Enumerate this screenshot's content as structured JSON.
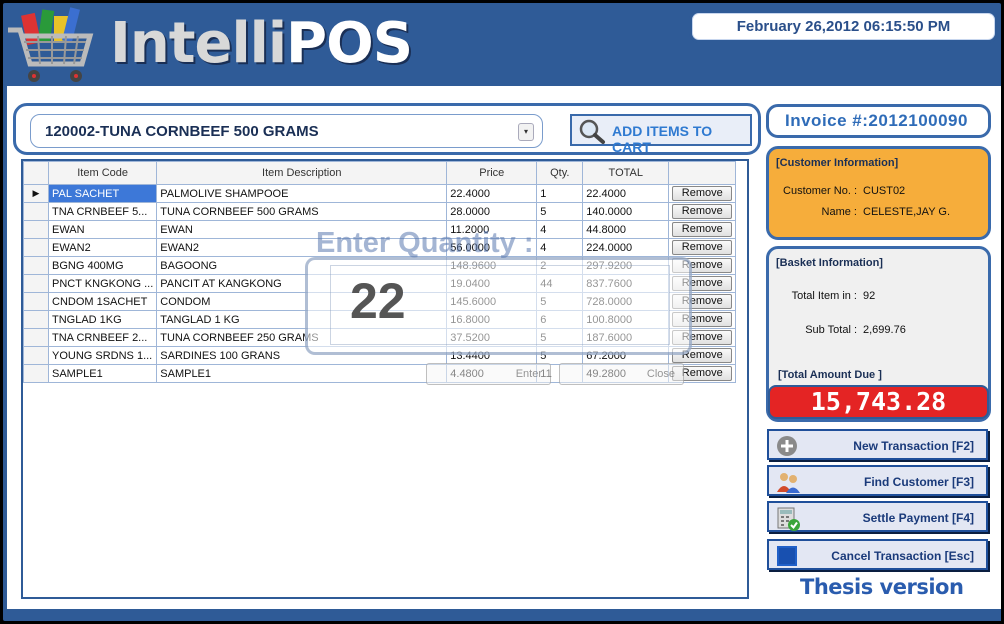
{
  "header": {
    "title_part1": "Intelli",
    "title_part2": "POS",
    "datetime": "February 26,2012 06:15:50 PM"
  },
  "search": {
    "selected_item": "120002-TUNA CORNBEEF 500 GRAMS",
    "add_button_label": "ADD ITEMS TO CART"
  },
  "grid": {
    "columns": [
      "Item Code",
      "Item Description",
      "Price",
      "Qty.",
      "TOTAL"
    ],
    "remove_label": "Remove",
    "rows": [
      {
        "code": "PAL SACHET",
        "desc": "PALMOLIVE SHAMPOOE",
        "price": "22.4000",
        "qty": "1",
        "total": "22.4000"
      },
      {
        "code": "TNA CRNBEEF 5...",
        "desc": "TUNA CORNBEEF 500 GRAMS",
        "price": "28.0000",
        "qty": "5",
        "total": "140.0000"
      },
      {
        "code": "EWAN",
        "desc": "EWAN",
        "price": "11.2000",
        "qty": "4",
        "total": "44.8000"
      },
      {
        "code": "EWAN2",
        "desc": "EWAN2",
        "price": "56.0000",
        "qty": "4",
        "total": "224.0000"
      },
      {
        "code": "BGNG 400MG",
        "desc": "BAGOONG",
        "price": "148.9600",
        "qty": "2",
        "total": "297.9200"
      },
      {
        "code": "PNCT KNGKONG ...",
        "desc": "PANCIT AT KANGKONG",
        "price": "19.0400",
        "qty": "44",
        "total": "837.7600"
      },
      {
        "code": "CNDOM 1SACHET",
        "desc": "CONDOM",
        "price": "145.6000",
        "qty": "5",
        "total": "728.0000"
      },
      {
        "code": "TNGLAD 1KG",
        "desc": "TANGLAD 1 KG",
        "price": "16.8000",
        "qty": "6",
        "total": "100.8000"
      },
      {
        "code": "TNA CRNBEEF 2...",
        "desc": "TUNA CORNBEEF 250 GRAMS",
        "price": "37.5200",
        "qty": "5",
        "total": "187.6000"
      },
      {
        "code": "YOUNG SRDNS 1...",
        "desc": "SARDINES 100 GRANS",
        "price": "13.4400",
        "qty": "5",
        "total": "67.2000"
      },
      {
        "code": "SAMPLE1",
        "desc": "SAMPLE1",
        "price": "4.4800",
        "qty": "11",
        "total": "49.2800"
      }
    ]
  },
  "quantity_dialog": {
    "title": "Enter Quantity :",
    "value": "22",
    "enter_label": "Enter",
    "close_label": "Close"
  },
  "invoice": {
    "label": "Invoice #:2012100090"
  },
  "customer": {
    "title": "[Customer Information]",
    "no_label": "Customer No. :",
    "no_value": "CUST02",
    "name_label": "Name :",
    "name_value": "CELESTE,JAY G."
  },
  "basket": {
    "title": "[Basket Information]",
    "items_label": "Total Item in :",
    "items_value": "92",
    "subtotal_label": "Sub Total :",
    "subtotal_value": "2,699.76",
    "due_label": "[Total Amount Due ]",
    "due_value": "15,743.28"
  },
  "actions": {
    "new": "New Transaction [F2]",
    "find": "Find Customer [F3]",
    "settle": "Settle Payment [F4]",
    "cancel": "Cancel Transaction [Esc]"
  },
  "footer": {
    "version": "Thesis version"
  },
  "colors": {
    "frame": "#2f5b97",
    "customer_box": "#f6ad3b",
    "total_due": "#e42424",
    "selection": "#3d78d8"
  }
}
